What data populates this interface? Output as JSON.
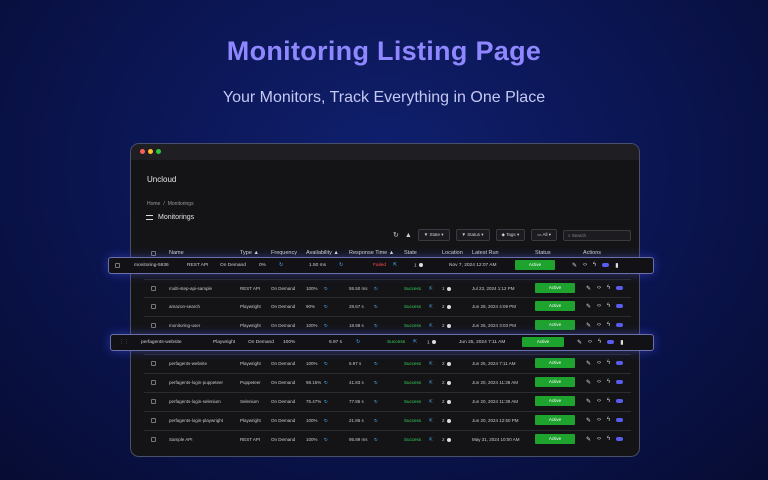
{
  "hero": {
    "title": "Monitoring Listing Page",
    "subtitle": "Your Monitors, Track Everything in One Place"
  },
  "app": {
    "name": "Uncloud"
  },
  "breadcrumb": [
    "Home",
    "Monitorings"
  ],
  "section_title": "Monitorings",
  "toolbar": {
    "state": "State",
    "status": "Status",
    "tags": "Tags",
    "view": "All",
    "search_placeholder": "Search"
  },
  "columns": [
    "Name",
    "Type",
    "Frequency",
    "Availability",
    "Response Time",
    "State",
    "Location",
    "Latest Run",
    "Status",
    "Actions"
  ],
  "colors": {
    "accent": "#8f87ff",
    "success": "#35d35a",
    "failed": "#ff4b4b",
    "active_button": "#1fa32f",
    "link": "#4fb4ff"
  },
  "icons": {
    "refresh": "refresh-icon",
    "clear": "clear-filter-icon",
    "edit": "pencil-icon",
    "code": "code-icon",
    "run": "lightning-icon",
    "toggle": "toggle-icon",
    "delete": "trash-icon",
    "link": "external-link-icon"
  },
  "featured_top": {
    "name": "monitoring-5936",
    "type": "REST API",
    "frequency": "On Demand",
    "availability": "0%",
    "response": "1.50 ms",
    "state": "Failed",
    "location": "1",
    "latest": "Nov 7, 2024 12:07 AM",
    "status": "Active"
  },
  "featured_mid": {
    "name": "perfagents-website",
    "type": "Playwright",
    "frequency": "On Demand",
    "availability": "100%",
    "response": "6.97 s",
    "state": "Success",
    "location": "1",
    "latest": "Jun 25, 2024 7:11 AM",
    "status": "Active"
  },
  "rows": [
    {
      "name": "multi-step-api-sample",
      "type": "REST API",
      "frequency": "On Demand",
      "availability": "100%",
      "response": "55.50 ms",
      "state": "Success",
      "location": "1",
      "latest": "Jul 23, 2024 1:12 PM",
      "status": "Active"
    },
    {
      "name": "amazon-search",
      "type": "Playwright",
      "frequency": "On Demand",
      "availability": "90%",
      "response": "28.67 s",
      "state": "Success",
      "location": "2",
      "latest": "Jun 28, 2024 4:09 PM",
      "status": "Active"
    },
    {
      "name": "monitoring-user",
      "type": "Playwright",
      "frequency": "On Demand",
      "availability": "100%",
      "response": "18.98 s",
      "state": "Success",
      "location": "2",
      "latest": "Jun 26, 2024 3:03 PM",
      "status": "Active"
    },
    {
      "name": "perfagents-website",
      "type": "Playwright",
      "frequency": "On Demand",
      "availability": "100%",
      "response": "6.97 s",
      "state": "Success",
      "location": "2",
      "latest": "Jun 25, 2024 7:11 AM",
      "status": "Active"
    },
    {
      "name": "perfagents-website",
      "type": "Playwright",
      "frequency": "On Demand",
      "availability": "100%",
      "response": "6.97 s",
      "state": "Success",
      "location": "2",
      "latest": "Jun 25, 2024 7:11 AM",
      "status": "Active"
    },
    {
      "name": "perfagents-login-puppeteer",
      "type": "Puppeteer",
      "frequency": "On Demand",
      "availability": "98.15%",
      "response": "41.83 s",
      "state": "Success",
      "location": "2",
      "latest": "Jun 20, 2024 11:38 AM",
      "status": "Active"
    },
    {
      "name": "perfagents-login-selenium",
      "type": "Selenium",
      "frequency": "On Demand",
      "availability": "75.47%",
      "response": "77.86 s",
      "state": "Success",
      "location": "2",
      "latest": "Jun 20, 2024 11:38 AM",
      "status": "Active"
    },
    {
      "name": "perfagents-login-playwright",
      "type": "Playwright",
      "frequency": "On Demand",
      "availability": "100%",
      "response": "21.86 s",
      "state": "Success",
      "location": "2",
      "latest": "Jun 20, 2024 12:50 PM",
      "status": "Active"
    },
    {
      "name": "Sample API",
      "type": "REST API",
      "frequency": "On Demand",
      "availability": "100%",
      "response": "95.89 ms",
      "state": "Success",
      "location": "2",
      "latest": "May 31, 2024 10:00 AM",
      "status": "Active"
    }
  ]
}
